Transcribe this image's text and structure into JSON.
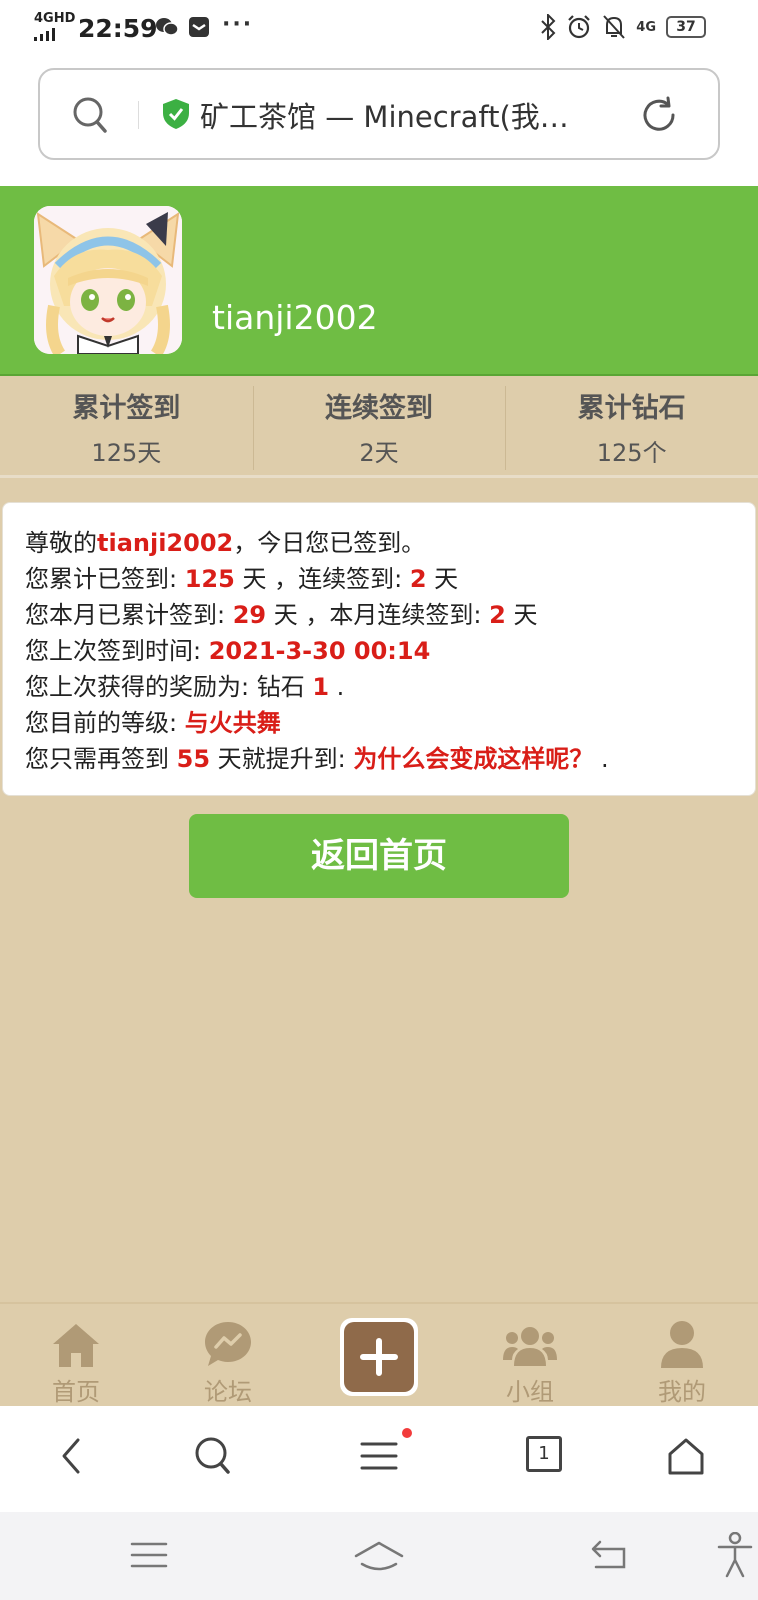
{
  "status_bar": {
    "signal": "4GHD",
    "time": "22:59",
    "more": "···",
    "network": "4G",
    "battery": "37"
  },
  "address_bar": {
    "title": "矿工茶馆 — Minecraft(我…"
  },
  "profile": {
    "username": "tianji2002"
  },
  "stats": [
    {
      "label": "累计签到",
      "value": "125天"
    },
    {
      "label": "连续签到",
      "value": "2天"
    },
    {
      "label": "累计钻石",
      "value": "125个"
    }
  ],
  "info": {
    "l1_a": "尊敬的",
    "l1_name": "tianji2002",
    "l1_b": "，今日您已签到。",
    "l2_a": "您累计已签到: ",
    "l2_total": "125",
    "l2_b": " 天 ，连续签到: ",
    "l2_cont": "2",
    "l2_c": " 天",
    "l3_a": "您本月已累计签到: ",
    "l3_month": "29",
    "l3_b": " 天 ，本月连续签到: ",
    "l3_mcont": "2",
    "l3_c": " 天",
    "l4_a": "您上次签到时间: ",
    "l4_time": "2021-3-30 00:14",
    "l5_a": "您上次获得的奖励为: 钻石 ",
    "l5_amount": "1",
    "l5_b": " .",
    "l6_a": "您目前的等级: ",
    "l6_level": "与火共舞",
    "l7_a": "您只需再签到 ",
    "l7_days": "55",
    "l7_b": " 天就提升到: ",
    "l7_next": "为什么会变成这样呢？",
    "l7_c": " ."
  },
  "home_button": "返回首页",
  "tabs": [
    {
      "label": "首页",
      "icon": "home-icon"
    },
    {
      "label": "论坛",
      "icon": "chat-bubble-icon"
    },
    {
      "label": "",
      "icon": "plus-icon"
    },
    {
      "label": "小组",
      "icon": "group-icon"
    },
    {
      "label": "我的",
      "icon": "person-icon"
    }
  ],
  "toolbar": {
    "tab_count": "1"
  },
  "colors": {
    "green": "#6fbd44",
    "beige": "#decdab",
    "highlight_red": "#d91e18",
    "tab_brown": "#8f6a4a"
  }
}
